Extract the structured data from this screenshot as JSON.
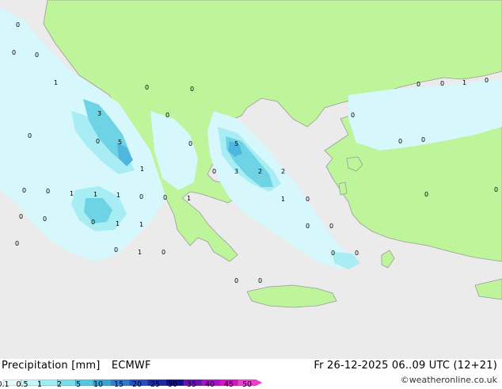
{
  "title": "Precipitation [mm]",
  "model": "ECMWF",
  "datetime": "Fr 26-12-2025 06..09 UTC (12+21)",
  "credit": "©weatheronline.co.uk",
  "colors": {
    "sea": "#ebebeb",
    "land": "#bef59b",
    "coast": "#9a9a9a"
  },
  "legend": {
    "ticks": [
      "0.1",
      "0.5",
      "1",
      "2",
      "5",
      "10",
      "15",
      "20",
      "25",
      "30",
      "35",
      "40",
      "45",
      "50"
    ],
    "colors": [
      "#e8fbfc",
      "#c6f4f9",
      "#a0ecf3",
      "#7adcea",
      "#55c6e0",
      "#3aa3d6",
      "#2f7bd0",
      "#2450c3",
      "#1b2aa8",
      "#10108a",
      "#6a12b8",
      "#a812c8",
      "#d514c7",
      "#ef3fd0"
    ]
  },
  "map_labels": [
    "0",
    "0",
    "0",
    "1",
    "3",
    "0",
    "5",
    "0",
    "1",
    "0",
    "0",
    "1",
    "1",
    "1",
    "0",
    "1",
    "0",
    "0",
    "1",
    "1",
    "0",
    "1",
    "0",
    "0",
    "0",
    "0",
    "0",
    "5",
    "3",
    "2",
    "2",
    "1",
    "0",
    "0",
    "0",
    "0",
    "0",
    "0",
    "0",
    "0",
    "0",
    "0",
    "0",
    "1",
    "0",
    "0",
    "0",
    "0",
    "0",
    "0",
    "0",
    "0"
  ]
}
